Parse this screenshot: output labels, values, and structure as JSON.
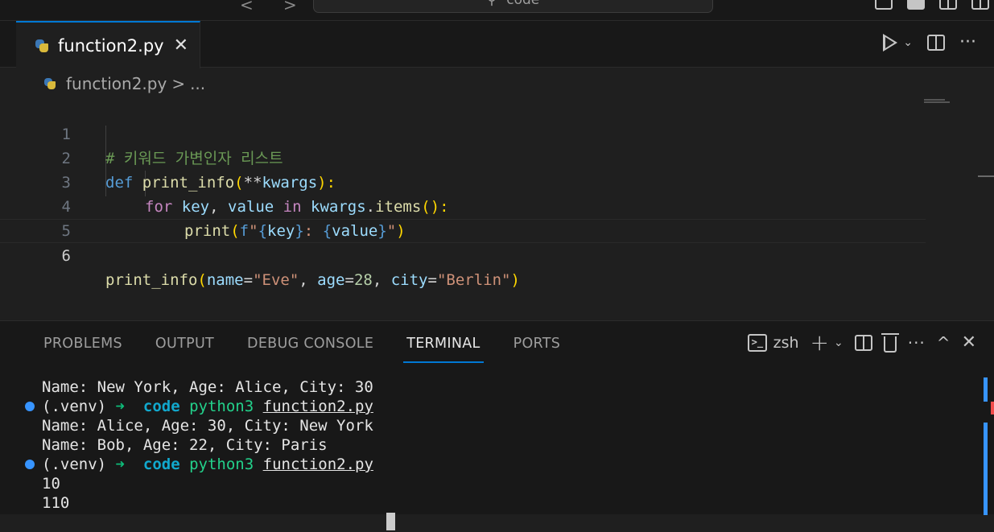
{
  "titlebar": {
    "back": "<",
    "forward": ">",
    "search_text": "code",
    "search_icon": "search-icon"
  },
  "tab": {
    "label": "function2.py",
    "close": "✕"
  },
  "breadcrumb": {
    "file": "function2.py",
    "separator": ">",
    "more": "..."
  },
  "editor": {
    "line_numbers": [
      "1",
      "2",
      "3",
      "4",
      "5",
      "6"
    ],
    "active_line": "6"
  },
  "code": {
    "l1": "# 키워드 가변인자 리스트",
    "l2_def": "def",
    "l2_fn": "print_info",
    "l2_open": "(",
    "l2_op": "**",
    "l2_arg": "kwargs",
    "l2_close": "):",
    "l3_for": "for",
    "l3_key": "key",
    "l3_comma": ", ",
    "l3_value": "value",
    "l3_in": "in",
    "l3_obj": "kwargs",
    "l3_dot": ".",
    "l3_method": "items",
    "l3_call": "():",
    "l4_fn": "print",
    "l4_open": "(",
    "l4_fstr_prefix": "f",
    "l4_q1": "\"",
    "l4_b1o": "{",
    "l4_key": "key",
    "l4_b1c": "}",
    "l4_mid": ": ",
    "l4_b2o": "{",
    "l4_value": "value",
    "l4_b2c": "}",
    "l4_q2": "\"",
    "l4_close": ")",
    "l6_fn": "print_info",
    "l6_open": "(",
    "l6_k1": "name",
    "l6_eq1": "=",
    "l6_v1": "\"Eve\"",
    "l6_c1": ", ",
    "l6_k2": "age",
    "l6_eq2": "=",
    "l6_v2": "28",
    "l6_c2": ", ",
    "l6_k3": "city",
    "l6_eq3": "=",
    "l6_v3": "\"Berlin\"",
    "l6_close": ")"
  },
  "panel": {
    "tabs": [
      "PROBLEMS",
      "OUTPUT",
      "DEBUG CONSOLE",
      "TERMINAL",
      "PORTS"
    ],
    "active_tab": "TERMINAL",
    "shell": "zsh",
    "plus": "+",
    "more": "···",
    "maximize": "^",
    "close": "✕"
  },
  "terminal": {
    "line1": "Name: New York, Age: Alice, City: 30",
    "prompt_env": "(.venv)",
    "prompt_arrow": "➜",
    "prompt_dir": "code",
    "cmd": "python3",
    "cmd_file": "function2.py",
    "line3": "Name: Alice, Age: 30, City: New York",
    "line4": "Name: Bob, Age: 22, City: Paris",
    "line6": "10",
    "line7": "110"
  },
  "colors": {
    "accent": "#0078d4",
    "background": "#1f1f1f",
    "panel_background": "#181818",
    "prompt_dot": "#3794ff"
  }
}
